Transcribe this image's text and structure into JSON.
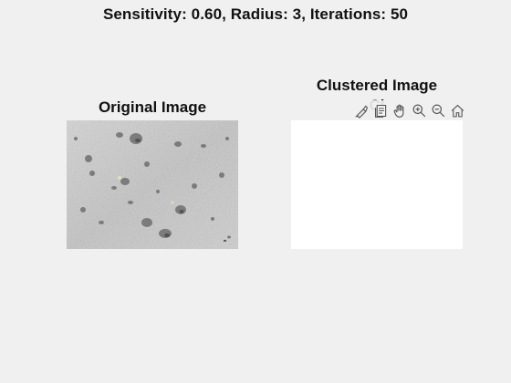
{
  "figure": {
    "title": "Sensitivity: 0.60, Radius: 3, Iterations: 50"
  },
  "left_axes": {
    "title": "Original Image"
  },
  "right_axes": {
    "title_line1": "Clustered Image",
    "title_line2": "Cl"
  },
  "toolbar": {
    "icons": [
      "brush-icon",
      "datatip-icon",
      "pan-icon",
      "zoom-in-icon",
      "zoom-out-icon",
      "home-icon"
    ]
  },
  "colors": {
    "background": "#f0f0f0",
    "image_base": "#c9c9c9",
    "clustered_fill": "#ffffff"
  }
}
